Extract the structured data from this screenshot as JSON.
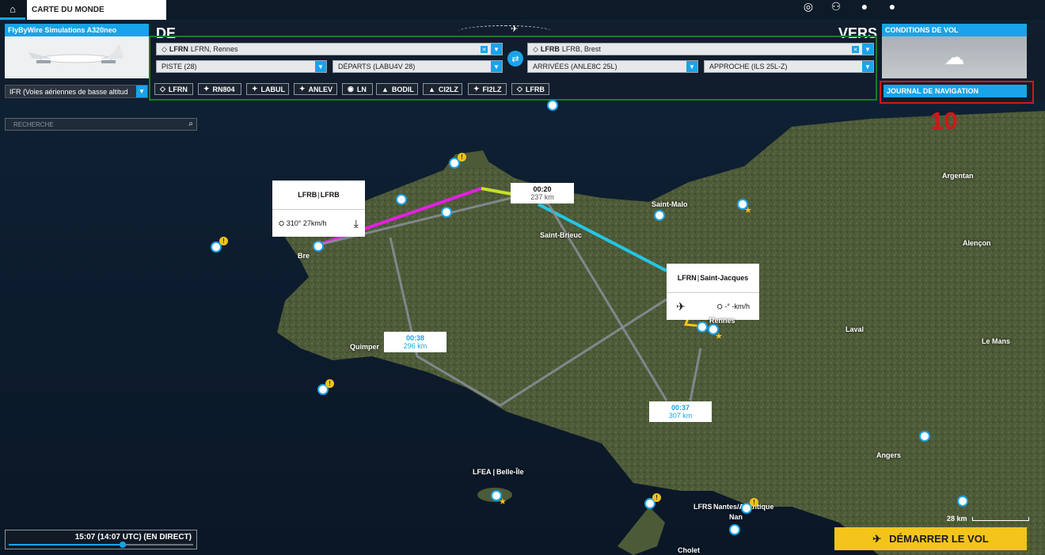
{
  "topbar": {
    "tab_title": "CARTE DU MONDE",
    "icons": [
      "home-icon",
      "achievements-icon",
      "community-icon",
      "profile-icon",
      "account-icon"
    ]
  },
  "aircraft": {
    "name": "FlyByWire Simulations A320neo"
  },
  "flight_rules": {
    "selected": "IFR (Voies aériennes de basse altitud"
  },
  "route": {
    "from_label": "DE",
    "to_label": "VERS",
    "departure": {
      "code": "LFRN",
      "name": "LFRN, Rennes"
    },
    "arrival": {
      "code": "LFRB",
      "name": "LFRB, Brest"
    },
    "runway": "PISTE (28)",
    "departure_procedure": "DÉPARTS (LABU4V 28)",
    "arrival_procedure": "ARRIVÉES (ANLE8C 25L)",
    "approach": "APPROCHE (ILS 25L-Z)",
    "waypoints": [
      {
        "name": "LFRN",
        "type": "airport"
      },
      {
        "name": "RN804",
        "type": "intersection"
      },
      {
        "name": "LABUL",
        "type": "intersection"
      },
      {
        "name": "ANLEV",
        "type": "intersection"
      },
      {
        "name": "LN",
        "type": "ndb"
      },
      {
        "name": "BODIL",
        "type": "fix"
      },
      {
        "name": "CI2LZ",
        "type": "fix"
      },
      {
        "name": "FI2LZ",
        "type": "intersection"
      },
      {
        "name": "LFRB",
        "type": "airport"
      }
    ]
  },
  "weather": {
    "title": "CONDITIONS DE VOL"
  },
  "nav_log": {
    "label": "JOURNAL DE NAVIGATION",
    "annotation_number": "10"
  },
  "search": {
    "placeholder": "RECHERCHE"
  },
  "map": {
    "arrival_box": {
      "code": "LFRB",
      "name": "LFRB",
      "wind": "310° 27km/h"
    },
    "departure_box": {
      "code": "LFRN",
      "name": "Saint-Jacques",
      "wind": "-° -km/h"
    },
    "legs": [
      {
        "time": "00:20",
        "distance": "237 km"
      },
      {
        "time": "00:38",
        "distance": "296 km"
      },
      {
        "time": "00:37",
        "distance": "307 km"
      }
    ],
    "cities": [
      "Saint-Malo",
      "Saint-Brieuc",
      "Argentan",
      "Alençon",
      "Laval",
      "Le Mans",
      "Quimper",
      "Angers",
      "Bre",
      "Nantes/Atlantique",
      "Nan",
      "Cholet",
      "Rennes"
    ],
    "belle_ile": {
      "code": "LFEA",
      "name": "Belle-Île"
    },
    "nantes": {
      "code": "LFRS"
    },
    "scale": "28 km"
  },
  "time": {
    "display": "15:07 (14:07 UTC) (EN DIRECT)",
    "day_progress": 0.62
  },
  "actions": {
    "start_flight": "DÉMARRER LE VOL"
  },
  "colors": {
    "accent": "#1aa3e8",
    "start": "#f3c41a",
    "highlight_red": "#d01818",
    "route_frame": "#1c7a28"
  }
}
